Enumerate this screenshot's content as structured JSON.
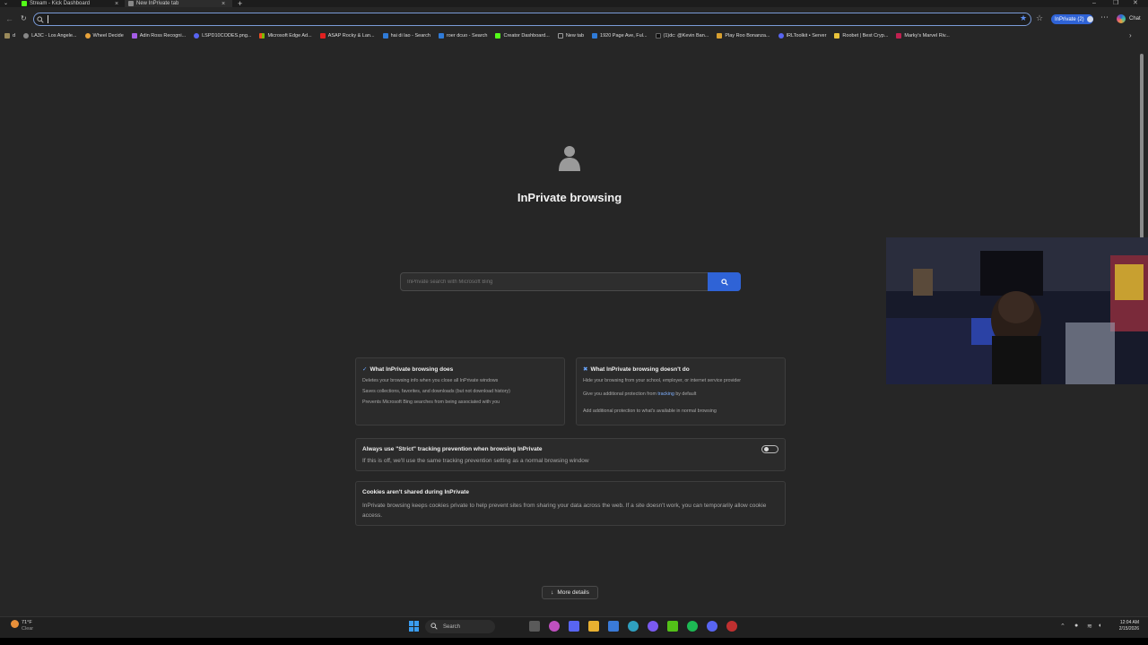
{
  "tabs": [
    {
      "label": "Stream - Kick Dashboard",
      "active": false,
      "icon_color": "#53fc18"
    },
    {
      "label": "New InPrivate tab",
      "active": true,
      "icon_color": "#aaaaaa"
    }
  ],
  "new_tab_symbol": "+",
  "close_symbol": "×",
  "window_controls": [
    "–",
    "❐",
    "✕"
  ],
  "address_bar": {
    "value": "",
    "placeholder": ""
  },
  "profile_pill": "InPrivate (2)",
  "chat_label": "Chat",
  "favorites": [
    {
      "label": "d",
      "color": "#9a8a5a"
    },
    {
      "label": "LA3C - Los Angele...",
      "color": "#cccccc"
    },
    {
      "label": "Wheel Decide",
      "color": "#e8a23a"
    },
    {
      "label": "Adin Ross Recogni...",
      "color": "#a45ce6"
    },
    {
      "label": "LSPD10CODES.png...",
      "color": "#5865f2"
    },
    {
      "label": "Microsoft Edge Ad...",
      "color": "#f25022"
    },
    {
      "label": "ASAP Rocky & Lan...",
      "color": "#e02020"
    },
    {
      "label": "hai di lao - Search",
      "color": "#2f7bd8"
    },
    {
      "label": "roer dcuo - Search",
      "color": "#2f7bd8"
    },
    {
      "label": "Creator Dashboard...",
      "color": "#53fc18"
    },
    {
      "label": "New tab",
      "color": "#999999"
    },
    {
      "label": "1920 Page Ave, Ful...",
      "color": "#2f7bd8"
    },
    {
      "label": "(1)dc: @Kevin Ban...",
      "color": "#111111"
    },
    {
      "label": "Play Roo Bonanza...",
      "color": "#d8a030"
    },
    {
      "label": "IRLToolkit • Server",
      "color": "#5865f2"
    },
    {
      "label": "Roobet | Best Cryp...",
      "color": "#e8c23a"
    },
    {
      "label": "Marky's Marvel Riv...",
      "color": "#c02050"
    }
  ],
  "main": {
    "title": "InPrivate browsing",
    "search_placeholder": "InPrivate search with Microsoft Bing",
    "does_card": {
      "title": "What InPrivate browsing does",
      "items": [
        "Deletes your browsing info when you close all InPrivate windows",
        "Saves collections, favorites, and downloads (but not download history)",
        "Prevents Microsoft Bing searches from being associated with you"
      ]
    },
    "doesnt_card": {
      "title": "What InPrivate browsing doesn't do",
      "item1": "Hide your browsing from your school, employer, or internet service provider",
      "item2_pre": "Give you additional protection from ",
      "item2_link": "tracking",
      "item2_post": " by default",
      "item3": "Add additional protection to what's available in normal browsing"
    },
    "strict_card": {
      "title": "Always use \"Strict\" tracking prevention when browsing InPrivate",
      "body": "If this is off, we'll use the same tracking prevention setting as a normal browsing window",
      "toggle_on": false
    },
    "cookies_card": {
      "title": "Cookies aren't shared during InPrivate",
      "body": "InPrivate browsing keeps cookies private to help prevent sites from sharing your data across the web. If a site doesn't work, you can temporarily allow cookie access."
    },
    "more_details": "More details"
  },
  "taskbar": {
    "weather_temp": "71°F",
    "weather_cond": "Clear",
    "search_label": "Search",
    "time": "12:04 AM",
    "date": "2/15/2026"
  },
  "colors": {
    "accent": "#2f63d6",
    "background": "#262626",
    "card": "#2b2b2b"
  }
}
